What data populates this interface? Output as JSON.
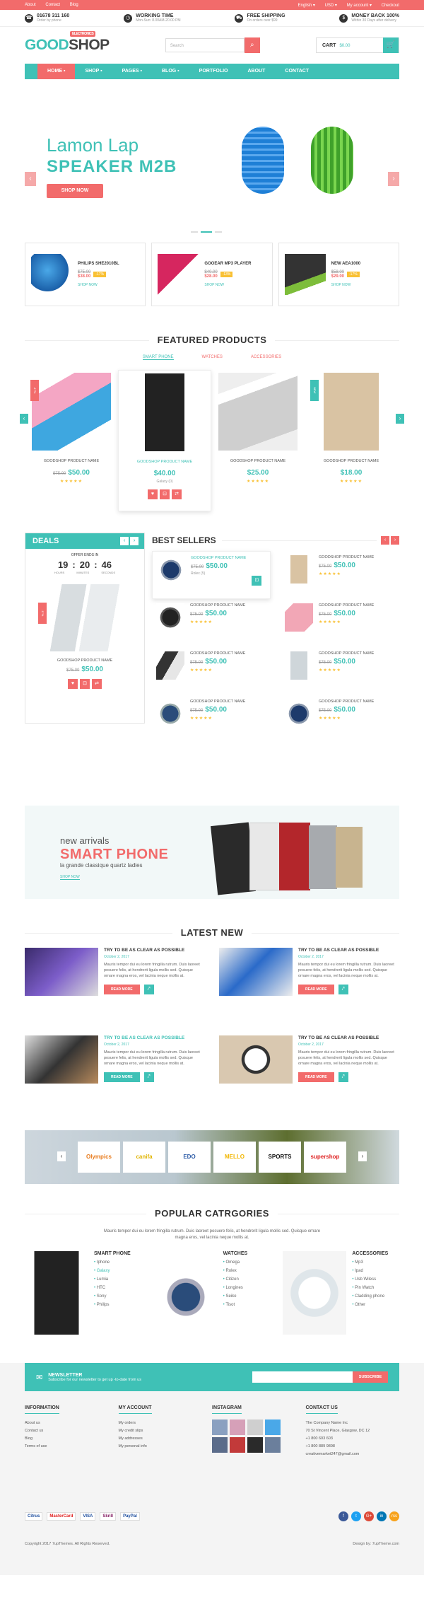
{
  "topbar": {
    "left": [
      "About",
      "Contact",
      "Blog"
    ],
    "lang": "English ▾",
    "curr": "USD ▾",
    "account": "My account ▾",
    "checkout": "Checkout"
  },
  "info": [
    {
      "icon": "phone-icon",
      "title": "01678 311 160",
      "sub": "Order by phone"
    },
    {
      "icon": "clock-icon",
      "title": "WORKING TIME",
      "sub": "Mon-Sun: 8.00AM-20.00 PM"
    },
    {
      "icon": "truck-icon",
      "title": "FREE SHIPPING",
      "sub": "On orders over $99"
    },
    {
      "icon": "money-icon",
      "title": "MONEY BACK 100%",
      "sub": "Within 30 Days after delivery"
    }
  ],
  "logo": {
    "a": "GOOD",
    "b": "SHOP",
    "tag": "ELECTRONICS"
  },
  "search": {
    "placeholder": "Search"
  },
  "cart": {
    "label": "CART",
    "amount": "$0.00"
  },
  "nav": [
    {
      "label": "HOME ▪"
    },
    {
      "label": "SHOP ▪"
    },
    {
      "label": "PAGES ▪"
    },
    {
      "label": "BLOG ▪"
    },
    {
      "label": "PORTFOLIO"
    },
    {
      "label": "ABOUT"
    },
    {
      "label": "CONTACT"
    }
  ],
  "hero": {
    "t1": "Lamon Lap",
    "t2": "SPEAKER M2B",
    "btn": "SHOP NOW",
    "accent": "#3fc1b6"
  },
  "promos": [
    {
      "name": "PHILIPS SHE2010BL",
      "old": "$75.00",
      "new": "$38.00",
      "off": "-17%",
      "cta": "SHOP NOW"
    },
    {
      "name": "GOOEAR MP3 PLAYER",
      "old": "$40.00",
      "new": "$28.00",
      "off": "-13%",
      "cta": "SHOP NOW"
    },
    {
      "name": "NEW AEA1000",
      "old": "$58.00",
      "new": "$29.00",
      "off": "-17%",
      "cta": "SHOP NOW"
    }
  ],
  "featured": {
    "title": "FEATURED PRODUCTS",
    "tabs": [
      "SMART PHONE",
      "WATCHES",
      "ACCESSORIES"
    ],
    "items": [
      {
        "name": "GOODSHOP PRODUCT NAME",
        "old": "$75.00",
        "price": "$50.00",
        "rib": "-17%"
      },
      {
        "name": "GOODSHOP PRODUCT NAME",
        "old": "",
        "price": "$40.00",
        "extra": "Galaxy (0)"
      },
      {
        "name": "GOODSHOP PRODUCT NAME",
        "old": "",
        "price": "$25.00"
      },
      {
        "name": "GOODSHOP PRODUCT NAME",
        "old": "",
        "price": "$18.00",
        "rib": "NEW"
      }
    ]
  },
  "deals": {
    "title": "DEALS",
    "offer": "OFFER ENDS IN",
    "h": "19",
    "m": "20",
    "s": "46",
    "hl": "HOURS",
    "ml": "MINUTES",
    "sl": "SECONDS",
    "name": "GOODSHOP PRODUCT NAME",
    "old": "$75.00",
    "price": "$50.00",
    "rib": "-17%"
  },
  "best": {
    "title": "BEST SELLERS",
    "items": [
      {
        "name": "GOODSHOP PRODUCT NAME",
        "old": "$75.00",
        "price": "$50.00",
        "extra": "Rolex (5)"
      },
      {
        "name": "GOODSHOP PRODUCT NAME",
        "old": "$75.00",
        "price": "$50.00"
      },
      {
        "name": "GOODSHOP PRODUCT NAME",
        "old": "$75.00",
        "price": "$50.00"
      },
      {
        "name": "GOODSHOP PRODUCT NAME",
        "old": "$75.00",
        "price": "$50.00"
      },
      {
        "name": "GOODSHOP PRODUCT NAME",
        "old": "$75.00",
        "price": "$50.00"
      },
      {
        "name": "GOODSHOP PRODUCT NAME",
        "old": "$75.00",
        "price": "$50.00"
      },
      {
        "name": "GOODSHOP PRODUCT NAME",
        "old": "$75.00",
        "price": "$50.00"
      },
      {
        "name": "GOODSHOP PRODUCT NAME",
        "old": "$75.00",
        "price": "$50.00"
      }
    ]
  },
  "banner": {
    "a": "new arrivals",
    "b": "SMART PHONE",
    "c": "la grande classique quartz ladies",
    "d": "SHOP NOW"
  },
  "latest": {
    "title": "LATEST NEW",
    "items": [
      {
        "title": "TRY TO BE AS CLEAR AS POSSIBLE",
        "date": "October 2, 2017",
        "text": "Mauris tempor dui eu lorem fringilla rutrum. Duis laoreet posuere felis, at hendrerit ligula mollis sed. Quisque ornare magna eros, vel lacinia neque mollis at.",
        "btn": "READ MORE"
      },
      {
        "title": "TRY TO BE AS CLEAR AS POSSIBLE",
        "date": "October 2, 2017",
        "text": "Mauris tempor dui eu lorem fringilla rutrum. Duis laoreet posuere felis, at hendrerit ligula mollis sed. Quisque ornare magna eros, vel lacinia neque mollis at.",
        "btn": "READ MORE"
      },
      {
        "title": "TRY TO BE AS CLEAR AS POSSIBLE",
        "date": "October 2, 2017",
        "text": "Mauris tempor dui eu lorem fringilla rutrum. Duis laoreet posuere felis, at hendrerit ligula mollis sed. Quisque ornare magna eros, vel lacinia neque mollis at.",
        "btn": "READ MORE"
      },
      {
        "title": "TRY TO BE AS CLEAR AS POSSIBLE",
        "date": "October 2, 2017",
        "text": "Mauris tempor dui eu lorem fringilla rutrum. Duis laoreet posuere felis, at hendrerit ligula mollis sed. Quisque ornare magna eros, vel lacinia neque mollis at.",
        "btn": "READ MORE"
      }
    ]
  },
  "brands": [
    "Olympics",
    "canifa",
    "EDO",
    "MELLO",
    "SPORTS",
    "supershop"
  ],
  "cats": {
    "title": "POPULAR CATRGORIES",
    "desc": "Mauris tempor dui eu lorem fringilla rutrum. Duis laoreet posuere felis, at hendrerit ligula mollis sed. Quisque ornare magna eros, vel lacinia neque mollis at.",
    "groups": [
      {
        "title": "SMART PHONE",
        "items": [
          "Iphone",
          "Galaxy",
          "Lumia",
          "HTC",
          "Sony",
          "Philips"
        ]
      },
      {
        "title": "WATCHES",
        "items": [
          "Omega",
          "Rolex",
          "Citizen",
          "Longines",
          "Seiko",
          "Tisot"
        ]
      },
      {
        "title": "ACCESSORIES",
        "items": [
          "Mp3",
          "Ipad",
          "Usb Wiless",
          "Pin Watch",
          "Cladding phone",
          "Other"
        ]
      }
    ]
  },
  "newsletter": {
    "title": "NEWSLETTER",
    "sub": "Subscribe for our newsletter to get up -to-date from us",
    "btn": "SUBSCRIBE"
  },
  "footer": {
    "info": {
      "title": "INFORMATION",
      "items": [
        "About us",
        "Contact us",
        "Blog",
        "Terms of use"
      ]
    },
    "acc": {
      "title": "MY ACCOUNT",
      "items": [
        "My orders",
        "My credit slips",
        "My addresses",
        "My personal info"
      ]
    },
    "ig": {
      "title": "INSTAGRAM"
    },
    "contact": {
      "title": "CONTACT US",
      "items": [
        "The Company Name Inc",
        "70 St Vincent Place, Glasgow, DC 12",
        "+1 800 603 603",
        "+1 800 889 9898",
        "creativemarket247@gmail.com"
      ]
    }
  },
  "pay": [
    "Citrus",
    "MasterCard",
    "VISA",
    "Skrill",
    "PayPal"
  ],
  "social": [
    "f",
    "t",
    "G+",
    "in",
    "rss"
  ],
  "copy": "Copyright 2017 7upThemes. All Rights Reserved.",
  "design": "Design by: 7upTheme.com"
}
